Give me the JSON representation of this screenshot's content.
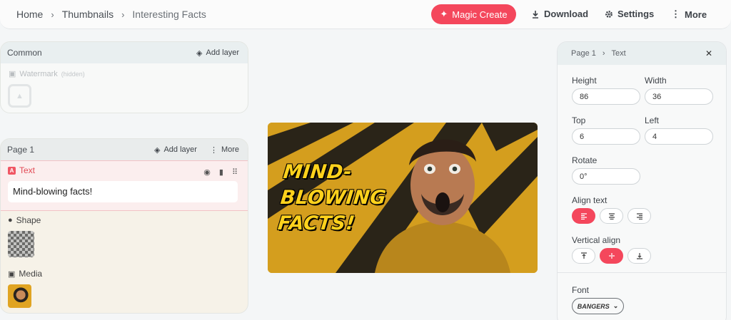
{
  "breadcrumb": [
    "Home",
    "Thumbnails",
    "Interesting Facts"
  ],
  "toolbar": {
    "magic_create": "Magic Create",
    "download": "Download",
    "settings": "Settings",
    "more": "More"
  },
  "common_panel": {
    "title": "Common",
    "add_layer": "Add layer",
    "watermark": "Watermark",
    "watermark_status": "(hidden)"
  },
  "page_panel": {
    "title": "Page 1",
    "add_layer": "Add layer",
    "more": "More",
    "text_layer": {
      "label": "Text",
      "badge": "A",
      "value": "Mind-blowing facts!"
    },
    "shape_layer": {
      "label": "Shape"
    },
    "media_layer": {
      "label": "Media"
    }
  },
  "canvas": {
    "line1": "MIND-",
    "line2": "BLOWING",
    "line3": "FACTS!"
  },
  "properties": {
    "crumb_page": "Page 1",
    "crumb_item": "Text",
    "close": "✕",
    "height_label": "Height",
    "height": "86",
    "width_label": "Width",
    "width": "36",
    "top_label": "Top",
    "top": "6",
    "left_label": "Left",
    "left": "4",
    "rotate_label": "Rotate",
    "rotate": "0°",
    "align_label": "Align text",
    "align_selected": "left",
    "valign_label": "Vertical align",
    "valign_selected": "middle",
    "font_label": "Font",
    "font": "BANGERS"
  },
  "colors": {
    "accent": "#f4475c",
    "headline": "#ffd21c",
    "canvas_bg": "#d49e1e"
  }
}
